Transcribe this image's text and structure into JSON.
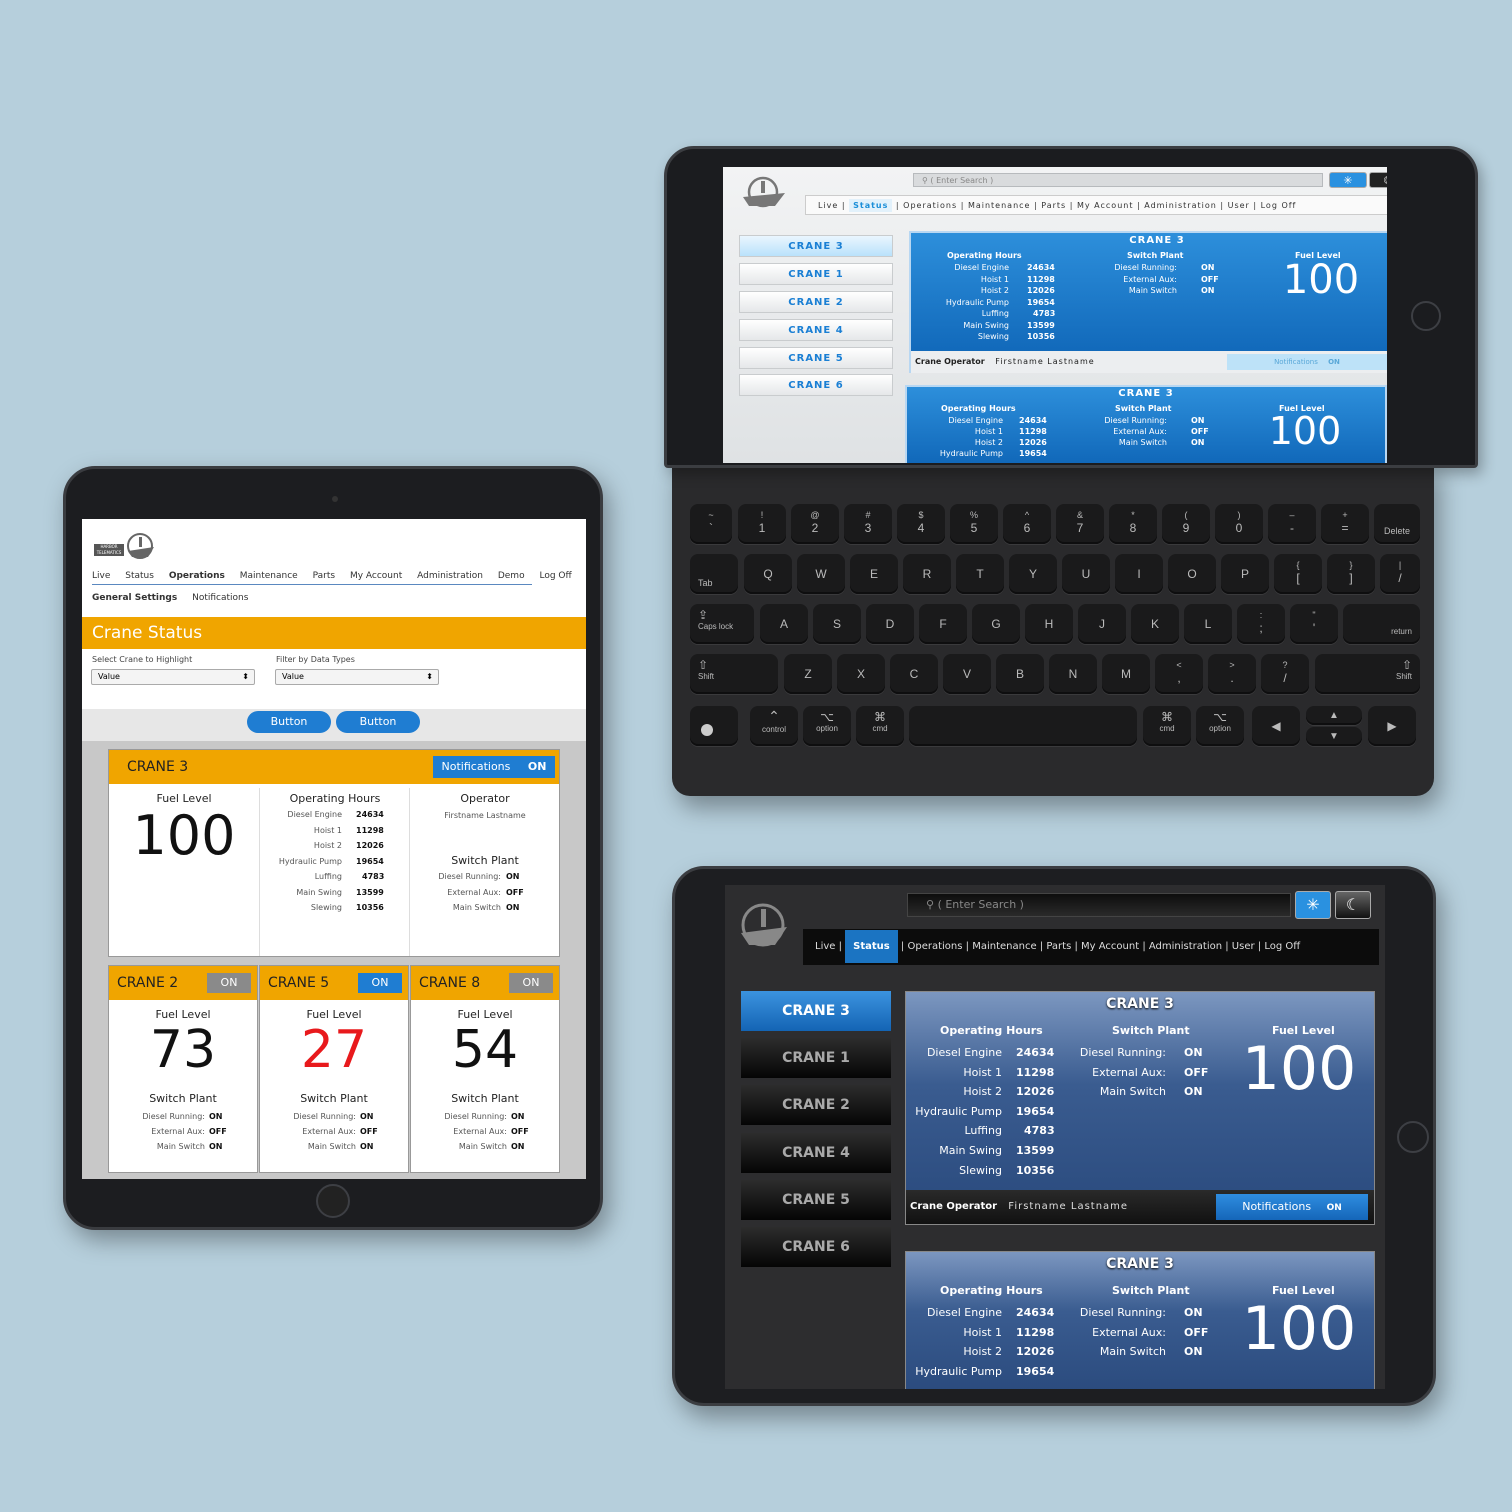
{
  "left_tablet": {
    "logo_text": "HARBOR TELEMATICS",
    "nav": [
      "Live",
      "Status",
      "Operations",
      "Maintenance",
      "Parts",
      "My Account",
      "Administration",
      "Demo",
      "Log Off"
    ],
    "nav_active": "Operations",
    "subnav": [
      "General Settings",
      "Notifications"
    ],
    "page_title": "Crane Status",
    "filter1": {
      "label": "Select Crane to Highlight",
      "value": "Value"
    },
    "filter2": {
      "label": "Filter by Data Types",
      "value": "Value"
    },
    "buttons": [
      "Button",
      "Button"
    ],
    "main_card": {
      "title": "CRANE 3",
      "notif_label": "Notifications",
      "notif_state": "ON",
      "fuel_label": "Fuel Level",
      "fuel_value": "100",
      "hours_label": "Operating Hours",
      "hours": [
        {
          "k": "Diesel Engine",
          "v": "24634"
        },
        {
          "k": "Hoist 1",
          "v": "11298"
        },
        {
          "k": "Hoist 2",
          "v": "12026"
        },
        {
          "k": "Hydraulic Pump",
          "v": "19654"
        },
        {
          "k": "Luffing",
          "v": "4783"
        },
        {
          "k": "Main Swing",
          "v": "13599"
        },
        {
          "k": "Slewing",
          "v": "10356"
        }
      ],
      "operator_label": "Operator",
      "operator_name": "Firstname Lastname",
      "switch_label": "Switch Plant",
      "switch": [
        {
          "k": "Diesel Running:",
          "v": "ON"
        },
        {
          "k": "External Aux:",
          "v": "OFF"
        },
        {
          "k": "Main Switch",
          "v": "ON"
        }
      ]
    },
    "small_cards": [
      {
        "title": "CRANE 2",
        "state": "ON",
        "fuel_label": "Fuel Level",
        "fuel": "73",
        "switch_label": "Switch Plant",
        "s1k": "Diesel Running:",
        "s1v": "ON",
        "s2k": "External Aux:",
        "s2v": "OFF",
        "s3k": "Main Switch",
        "s3v": "ON"
      },
      {
        "title": "CRANE 5",
        "state": "ON",
        "fuel_label": "Fuel Level",
        "fuel": "27",
        "switch_label": "Switch Plant",
        "s1k": "Diesel Running:",
        "s1v": "ON",
        "s2k": "External Aux:",
        "s2v": "OFF",
        "s3k": "Main Switch",
        "s3v": "ON"
      },
      {
        "title": "CRANE 8",
        "state": "ON",
        "fuel_label": "Fuel Level",
        "fuel": "54",
        "switch_label": "Switch Plant",
        "s1k": "Diesel Running:",
        "s1v": "ON",
        "s2k": "External Aux:",
        "s2v": "OFF",
        "s3k": "Main Switch",
        "s3v": "ON"
      }
    ],
    "colors": {
      "accent": "#f0a500",
      "button": "#1f7dd2",
      "alert": "#e8191c"
    }
  },
  "top_tablet": {
    "search_placeholder": "( Enter Search )",
    "nav": [
      "Live",
      "Status",
      "Operations",
      "Maintenance",
      "Parts",
      "My Account",
      "Administration",
      "User",
      "Log Off"
    ],
    "nav_active": "Status",
    "sidebar": [
      "CRANE 3",
      "CRANE 1",
      "CRANE 2",
      "CRANE 4",
      "CRANE 5",
      "CRANE 6"
    ],
    "panel1": {
      "title": "CRANE 3",
      "hours_label": "Operating Hours",
      "switch_label": "Switch Plant",
      "fuel_label": "Fuel Level",
      "fuel": "100",
      "hours": [
        {
          "k": "Diesel Engine",
          "v": "24634"
        },
        {
          "k": "Hoist 1",
          "v": "11298"
        },
        {
          "k": "Hoist 2",
          "v": "12026"
        },
        {
          "k": "Hydraulic Pump",
          "v": "19654"
        },
        {
          "k": "Luffing",
          "v": "4783"
        },
        {
          "k": "Main Swing",
          "v": "13599"
        },
        {
          "k": "Slewing",
          "v": "10356"
        }
      ],
      "switch": [
        {
          "k": "Diesel Running:",
          "v": "ON"
        },
        {
          "k": "External Aux:",
          "v": "OFF"
        },
        {
          "k": "Main Switch",
          "v": "ON"
        }
      ],
      "operator_label": "Crane Operator",
      "operator_name": "Firstname Lastname",
      "notif_label": "Notifications",
      "notif_state": "ON"
    },
    "panel2": {
      "title": "CRANE 3",
      "hours_label": "Operating Hours",
      "switch_label": "Switch Plant",
      "fuel_label": "Fuel Level",
      "fuel": "100",
      "hours": [
        {
          "k": "Diesel Engine",
          "v": "24634"
        },
        {
          "k": "Hoist 1",
          "v": "11298"
        },
        {
          "k": "Hoist 2",
          "v": "12026"
        },
        {
          "k": "Hydraulic Pump",
          "v": "19654"
        }
      ],
      "switch": [
        {
          "k": "Diesel Running:",
          "v": "ON"
        },
        {
          "k": "External Aux:",
          "v": "OFF"
        },
        {
          "k": "Main Switch",
          "v": "ON"
        }
      ]
    }
  },
  "keyboard": {
    "row1": [
      [
        "~",
        "`"
      ],
      [
        "!",
        "1"
      ],
      [
        "@",
        "2"
      ],
      [
        "#",
        "3"
      ],
      [
        "$",
        "4"
      ],
      [
        "%",
        "5"
      ],
      [
        "^",
        "6"
      ],
      [
        "&",
        "7"
      ],
      [
        "*",
        "8"
      ],
      [
        "(",
        "9"
      ],
      [
        ")",
        "0"
      ],
      [
        "–",
        "-"
      ],
      [
        "+",
        "="
      ]
    ],
    "delete": "Delete",
    "tab": "Tab",
    "row2": [
      "Q",
      "W",
      "E",
      "R",
      "T",
      "Y",
      "U",
      "I",
      "O",
      "P"
    ],
    "row2b": [
      [
        "{",
        "["
      ],
      [
        "}",
        "]"
      ],
      [
        "|",
        "/"
      ]
    ],
    "caps": "Caps lock",
    "row3": [
      "A",
      "S",
      "D",
      "F",
      "G",
      "H",
      "J",
      "K",
      "L"
    ],
    "row3b": [
      [
        ":",
        ";"
      ],
      [
        "\"",
        "'"
      ]
    ],
    "return": "return",
    "shift": "Shift",
    "row4": [
      "Z",
      "X",
      "C",
      "V",
      "B",
      "N",
      "M"
    ],
    "row4b": [
      [
        "<",
        ","
      ],
      [
        ">",
        "."
      ],
      [
        "?",
        "/"
      ]
    ],
    "control": "control",
    "option": "option",
    "cmd": "cmd"
  },
  "bottom_tablet": {
    "search_placeholder": "( Enter Search )",
    "nav": [
      "Live",
      "Status",
      "Operations",
      "Maintenance",
      "Parts",
      "My Account",
      "Administration",
      "User",
      "Log Off"
    ],
    "nav_active": "Status",
    "sidebar": [
      "CRANE 3",
      "CRANE 1",
      "CRANE 2",
      "CRANE 4",
      "CRANE 5",
      "CRANE 6"
    ],
    "panel1": {
      "title": "CRANE 3",
      "hours_label": "Operating Hours",
      "switch_label": "Switch Plant",
      "fuel_label": "Fuel Level",
      "fuel": "100",
      "hours": [
        {
          "k": "Diesel Engine",
          "v": "24634"
        },
        {
          "k": "Hoist 1",
          "v": "11298"
        },
        {
          "k": "Hoist 2",
          "v": "12026"
        },
        {
          "k": "Hydraulic Pump",
          "v": "19654"
        },
        {
          "k": "Luffing",
          "v": "4783"
        },
        {
          "k": "Main Swing",
          "v": "13599"
        },
        {
          "k": "Slewing",
          "v": "10356"
        }
      ],
      "switch": [
        {
          "k": "Diesel Running:",
          "v": "ON"
        },
        {
          "k": "External Aux:",
          "v": "OFF"
        },
        {
          "k": "Main Switch",
          "v": "ON"
        }
      ],
      "operator_label": "Crane Operator",
      "operator_name": "Firstname Lastname",
      "notif_label": "Notifications",
      "notif_state": "ON"
    },
    "panel2": {
      "title": "CRANE 3",
      "hours_label": "Operating Hours",
      "switch_label": "Switch Plant",
      "fuel_label": "Fuel Level",
      "fuel": "100",
      "hours": [
        {
          "k": "Diesel Engine",
          "v": "24634"
        },
        {
          "k": "Hoist 1",
          "v": "11298"
        },
        {
          "k": "Hoist 2",
          "v": "12026"
        },
        {
          "k": "Hydraulic Pump",
          "v": "19654"
        }
      ],
      "switch": [
        {
          "k": "Diesel Running:",
          "v": "ON"
        },
        {
          "k": "External Aux:",
          "v": "OFF"
        },
        {
          "k": "Main Switch",
          "v": "ON"
        }
      ]
    }
  }
}
